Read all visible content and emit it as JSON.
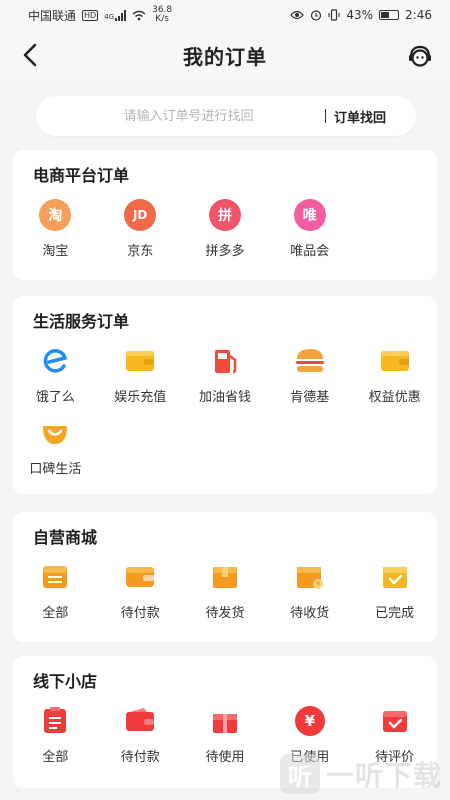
{
  "status_bar": {
    "carrier": "中国联通",
    "network_badge": "HD",
    "network_gen": "4G",
    "speed_value": "36.8",
    "speed_unit": "K/s",
    "battery_percent": "43%",
    "time": "2:46"
  },
  "header": {
    "title": "我的订单",
    "back_icon": "chevron-left-icon",
    "service_icon": "customer-service-icon"
  },
  "search": {
    "placeholder": "请输入订单号进行找回",
    "value": "",
    "button_label": "订单找回"
  },
  "sections": {
    "ecommerce": {
      "title": "电商平台订单",
      "items": [
        {
          "label": "淘宝",
          "glyph": "淘",
          "icon": "taobao-icon",
          "color": "#f5a05a"
        },
        {
          "label": "京东",
          "glyph": "JD",
          "icon": "jd-icon",
          "color": "#f06a4a"
        },
        {
          "label": "拼多多",
          "glyph": "拼",
          "icon": "pinduoduo-icon",
          "color": "#f0566a"
        },
        {
          "label": "唯品会",
          "glyph": "唯",
          "icon": "vip-icon",
          "color": "#f25ca0"
        }
      ]
    },
    "life": {
      "title": "生活服务订单",
      "items": [
        {
          "label": "饿了么",
          "icon": "eleme-icon",
          "color": "#1e8ff2"
        },
        {
          "label": "娱乐充值",
          "icon": "wallet-icon",
          "color": "#f7b81e"
        },
        {
          "label": "加油省钱",
          "icon": "fuel-pump-icon",
          "color": "#ef4a3a"
        },
        {
          "label": "肯德基",
          "icon": "burger-icon",
          "color": "#f4a23a"
        },
        {
          "label": "权益优惠",
          "icon": "card-wallet-icon",
          "color": "#f7b81e"
        },
        {
          "label": "口碑生活",
          "icon": "smile-icon",
          "color": "#f6a523"
        }
      ]
    },
    "self_mall": {
      "title": "自营商城",
      "items": [
        {
          "label": "全部",
          "icon": "list-box-icon",
          "color": "#f59a1e"
        },
        {
          "label": "待付款",
          "icon": "wallet-icon",
          "color": "#f59a1e"
        },
        {
          "label": "待发货",
          "icon": "package-icon",
          "color": "#f59a1e"
        },
        {
          "label": "待收货",
          "icon": "delivery-box-icon",
          "color": "#f59a1e"
        },
        {
          "label": "已完成",
          "icon": "completed-box-icon",
          "color": "#f7b81e"
        }
      ]
    },
    "offline": {
      "title": "线下小店",
      "items": [
        {
          "label": "全部",
          "icon": "list-box-icon",
          "color": "#ef3b3b"
        },
        {
          "label": "待付款",
          "icon": "wallet-icon",
          "color": "#ef3b3b"
        },
        {
          "label": "待使用",
          "icon": "gift-box-icon",
          "color": "#ef3b3b"
        },
        {
          "label": "已使用",
          "glyph": "¥",
          "icon": "yen-coin-icon",
          "color": "#ef3b3b"
        },
        {
          "label": "待评价",
          "icon": "review-check-icon",
          "color": "#ef3b3b"
        }
      ]
    }
  },
  "watermark": {
    "logo_glyph": "听",
    "text": "一听下载"
  }
}
